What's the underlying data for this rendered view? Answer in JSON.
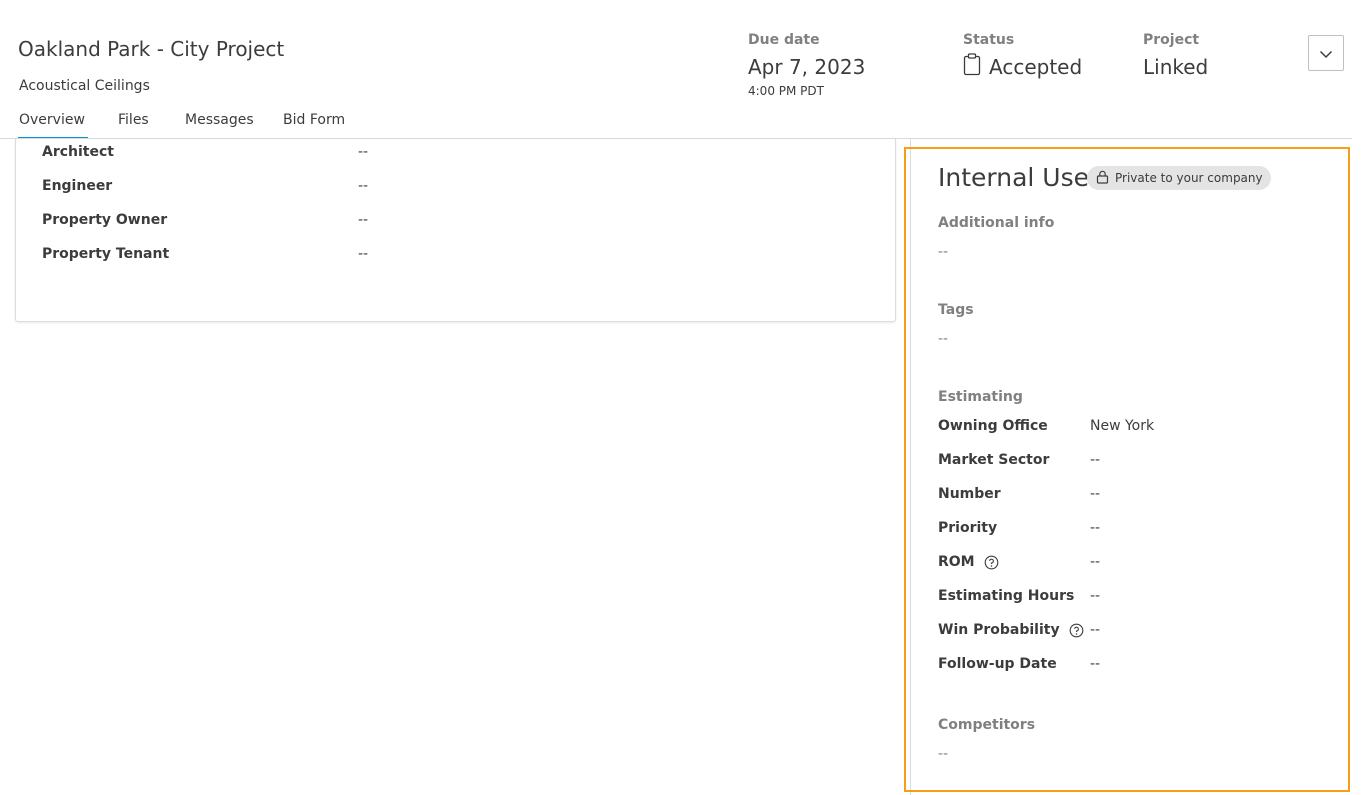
{
  "header": {
    "title": "Oakland Park - City Project",
    "subtitle": "Acoustical Ceilings",
    "due_date": {
      "label": "Due date",
      "value": "Apr 7, 2023",
      "time": "4:00 PM PDT"
    },
    "status": {
      "label": "Status",
      "value": "Accepted"
    },
    "project": {
      "label": "Project",
      "value": "Linked"
    }
  },
  "tabs": [
    {
      "label": "Overview",
      "active": true
    },
    {
      "label": "Files"
    },
    {
      "label": "Messages"
    },
    {
      "label": "Bid Form"
    }
  ],
  "overview": {
    "rows": [
      {
        "label": "Architect",
        "value": "--"
      },
      {
        "label": "Engineer",
        "value": "--"
      },
      {
        "label": "Property Owner",
        "value": "--"
      },
      {
        "label": "Property Tenant",
        "value": "--"
      }
    ]
  },
  "internal_use": {
    "title": "Internal Use",
    "badge": "Private to your company",
    "additional_info": {
      "label": "Additional info",
      "value": "--"
    },
    "tags": {
      "label": "Tags",
      "value": "--"
    },
    "estimating": {
      "label": "Estimating",
      "rows": [
        {
          "label": "Owning Office",
          "value": "New York"
        },
        {
          "label": "Market Sector",
          "value": "--"
        },
        {
          "label": "Number",
          "value": "--"
        },
        {
          "label": "Priority",
          "value": "--"
        },
        {
          "label": "ROM",
          "value": "--"
        },
        {
          "label": "Estimating Hours",
          "value": "--"
        },
        {
          "label": "Win Probability",
          "value": "--"
        },
        {
          "label": "Follow-up Date",
          "value": "--"
        }
      ]
    },
    "competitors": {
      "label": "Competitors",
      "value": "--"
    }
  },
  "colors": {
    "accent": "#0696d7",
    "highlight": "#f89c1c",
    "muted": "#808080",
    "text": "#3c3c3c"
  },
  "icons": [
    "clipboard-icon",
    "chevron-down-icon",
    "lock-icon",
    "help-circle-icon"
  ]
}
